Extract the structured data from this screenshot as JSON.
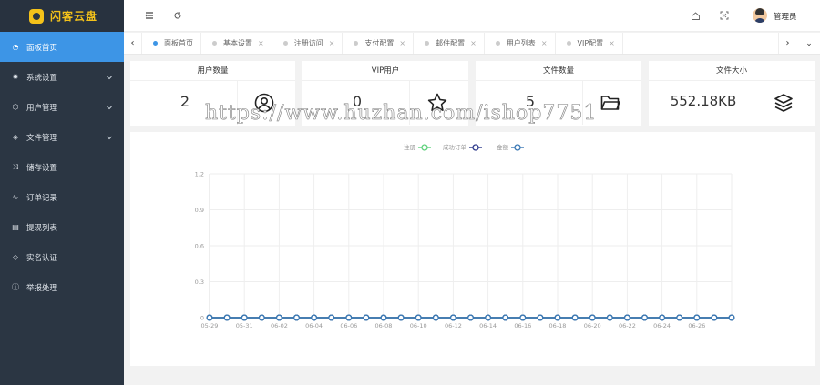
{
  "app": {
    "logo_text": "闪客云盘"
  },
  "sidebar": {
    "items": [
      {
        "label": "面板首页",
        "icon": "dashboard-icon",
        "glyph": "◔",
        "active": true,
        "has_arrow": false
      },
      {
        "label": "系统设置",
        "icon": "gear-icon",
        "glyph": "✹",
        "active": false,
        "has_arrow": true
      },
      {
        "label": "用户管理",
        "icon": "user-cube-icon",
        "glyph": "⬡",
        "active": false,
        "has_arrow": true
      },
      {
        "label": "文件管理",
        "icon": "layers-icon",
        "glyph": "◈",
        "active": false,
        "has_arrow": true
      },
      {
        "label": "储存设置",
        "icon": "shuffle-icon",
        "glyph": "⤨",
        "active": false,
        "has_arrow": false
      },
      {
        "label": "订单记录",
        "icon": "pulse-icon",
        "glyph": "∿",
        "active": false,
        "has_arrow": false
      },
      {
        "label": "提现列表",
        "icon": "document-icon",
        "glyph": "▤",
        "active": false,
        "has_arrow": false
      },
      {
        "label": "实名认证",
        "icon": "shield-icon",
        "glyph": "◇",
        "active": false,
        "has_arrow": false
      },
      {
        "label": "举报处理",
        "icon": "alert-icon",
        "glyph": "ⓘ",
        "active": false,
        "has_arrow": false
      }
    ]
  },
  "topbar": {
    "admin_name": "管理员"
  },
  "tabs": [
    {
      "label": "面板首页",
      "active": true,
      "closable": false
    },
    {
      "label": "基本设置",
      "active": false,
      "closable": true
    },
    {
      "label": "注册访问",
      "active": false,
      "closable": true
    },
    {
      "label": "支付配置",
      "active": false,
      "closable": true
    },
    {
      "label": "邮件配置",
      "active": false,
      "closable": true
    },
    {
      "label": "用户列表",
      "active": false,
      "closable": true
    },
    {
      "label": "VIP配置",
      "active": false,
      "closable": true
    }
  ],
  "stats": [
    {
      "title": "用户数量",
      "value": "2",
      "icon": "user-circle-icon"
    },
    {
      "title": "VIP用户",
      "value": "0",
      "icon": "star-icon"
    },
    {
      "title": "文件数量",
      "value": "5",
      "icon": "folder-icon"
    },
    {
      "title": "文件大小",
      "value": "552.18KB",
      "icon": "stack-icon"
    }
  ],
  "watermark": "https://www.huzhan.com/ishop7751",
  "chart_data": {
    "type": "line",
    "title": "",
    "xlabel": "",
    "ylabel": "",
    "ylim": [
      0,
      1.2
    ],
    "yticks": [
      "0",
      "0.3",
      "0.6",
      "0.9",
      "1.2"
    ],
    "x": [
      "05-29",
      "05-30",
      "05-31",
      "06-01",
      "06-02",
      "06-03",
      "06-04",
      "06-05",
      "06-06",
      "06-07",
      "06-08",
      "06-09",
      "06-10",
      "06-11",
      "06-12",
      "06-13",
      "06-14",
      "06-15",
      "06-16",
      "06-17",
      "06-18",
      "06-19",
      "06-20",
      "06-21",
      "06-22",
      "06-23",
      "06-24",
      "06-25",
      "06-26",
      "06-27",
      "06-28"
    ],
    "xtick_labels": [
      "05-29",
      "05-31",
      "06-02",
      "06-04",
      "06-06",
      "06-08",
      "06-10",
      "06-12",
      "06-14",
      "06-16",
      "06-18",
      "06-20",
      "06-22",
      "06-24",
      "06-26"
    ],
    "legend_position": "top-center",
    "grid": true,
    "series": [
      {
        "name": "注册",
        "color": "#5fd27d",
        "values": [
          0,
          0,
          0,
          0,
          0,
          0,
          0,
          0,
          0,
          0,
          0,
          0,
          0,
          0,
          0,
          0,
          0,
          0,
          0,
          0,
          0,
          0,
          0,
          0,
          0,
          0,
          0,
          0,
          0,
          0,
          0
        ]
      },
      {
        "name": "成功订单",
        "color": "#2e3a8c",
        "values": [
          0,
          0,
          0,
          0,
          0,
          0,
          0,
          0,
          0,
          0,
          0,
          0,
          0,
          0,
          0,
          0,
          0,
          0,
          0,
          0,
          0,
          0,
          0,
          0,
          0,
          0,
          0,
          0,
          0,
          0,
          0
        ]
      },
      {
        "name": "金额",
        "color": "#3a78b5",
        "values": [
          0,
          0,
          0,
          0,
          0,
          0,
          0,
          0,
          0,
          0,
          0,
          0,
          0,
          0,
          0,
          0,
          0,
          0,
          0,
          0,
          0,
          0,
          0,
          0,
          0,
          0,
          0,
          0,
          0,
          0,
          0
        ]
      }
    ]
  }
}
